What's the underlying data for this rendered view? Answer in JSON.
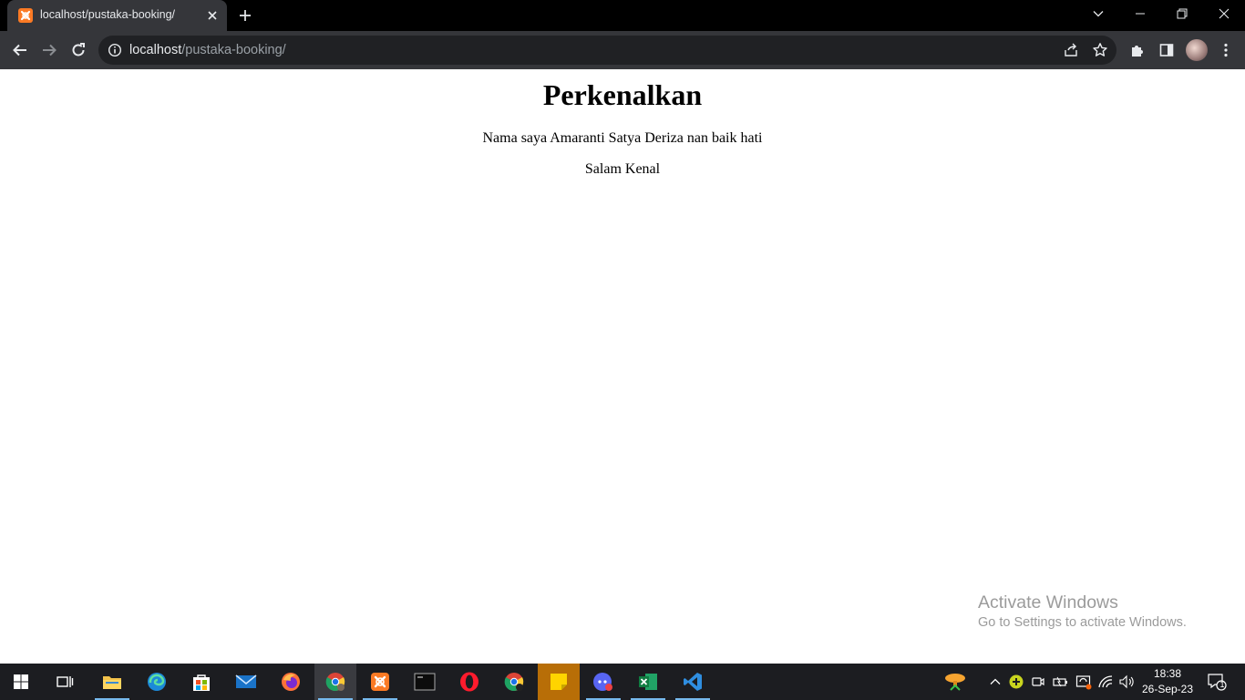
{
  "browser": {
    "tab": {
      "title": "localhost/pustaka-booking/"
    },
    "omnibox": {
      "url_host": "localhost",
      "url_path": "/pustaka-booking/"
    }
  },
  "page": {
    "heading": "Perkenalkan",
    "paragraphs": [
      "Nama saya Amaranti Satya Deriza nan baik hati",
      "Salam Kenal"
    ]
  },
  "watermark": {
    "line1": "Activate Windows",
    "line2": "Go to Settings to activate Windows."
  },
  "taskbar": {
    "apps": [
      "start-icon",
      "task-view-icon",
      "file-explorer-icon",
      "edge-icon",
      "store-icon",
      "mail-icon",
      "firefox-icon",
      "chrome-icon",
      "xampp-icon",
      "terminal-icon",
      "opera-icon",
      "chrome-icon",
      "sticky-notes-icon",
      "discord-icon",
      "excel-icon",
      "vscode-icon"
    ],
    "clock": {
      "time": "18:38",
      "date": "26-Sep-23"
    },
    "notification_count": "1"
  },
  "colors": {
    "tab_bg": "#35363a",
    "titlebar_bg": "#000000",
    "omnibox_bg": "#202124",
    "taskbar_bg": "#1c1d21",
    "xampp_orange": "#fb7a24"
  }
}
